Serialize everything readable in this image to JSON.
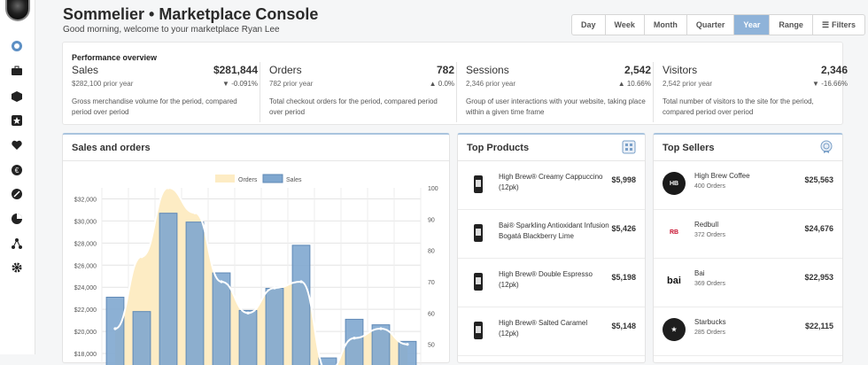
{
  "header": {
    "title": "Sommelier • Marketplace Console",
    "greeting": "Good morning, welcome to your marketplace Ryan Lee"
  },
  "ranges": [
    {
      "label": "Day",
      "active": false
    },
    {
      "label": "Week",
      "active": false
    },
    {
      "label": "Month",
      "active": false
    },
    {
      "label": "Quarter",
      "active": false
    },
    {
      "label": "Year",
      "active": true
    },
    {
      "label": "Range",
      "active": false
    },
    {
      "label": "Filters",
      "active": false,
      "icon": "sliders-icon"
    }
  ],
  "sidebar": {
    "icons": [
      "compass-icon",
      "briefcase-icon",
      "cube-icon",
      "star-box-icon",
      "heart-icon",
      "euro-icon",
      "tag-icon",
      "pie-icon",
      "network-icon",
      "gear-icon"
    ]
  },
  "overview": {
    "title": "Performance overview",
    "metrics": [
      {
        "name": "Sales",
        "value": "$281,844",
        "prior": "$282,100 prior year",
        "delta": "-0.091%",
        "direction": "down",
        "desc": "Gross merchandise volume for the period, compared period over period"
      },
      {
        "name": "Orders",
        "value": "782",
        "prior": "782 prior year",
        "delta": "0.0%",
        "direction": "up",
        "desc": "Total checkout orders for the period, compared period over period"
      },
      {
        "name": "Sessions",
        "value": "2,542",
        "prior": "2,346 prior year",
        "delta": "10.66%",
        "direction": "up",
        "desc": "Group of user interactions with your website, taking place within a given time frame"
      },
      {
        "name": "Visitors",
        "value": "2,346",
        "prior": "2,542 prior year",
        "delta": "-16.66%",
        "direction": "down",
        "desc": "Total number of visitors to the site for the period, compared period over period"
      }
    ]
  },
  "sales_card": {
    "title": "Sales and orders"
  },
  "products_card": {
    "title": "Top Products",
    "items": [
      {
        "name": "High Brew® Creamy Cappuccino (12pk)",
        "price": "$5,998"
      },
      {
        "name": "Bai® Sparkling Antioxidant Infusion Bogatá Blackberry Lime",
        "price": "$5,426"
      },
      {
        "name": "High Brew® Double Espresso (12pk)",
        "price": "$5,198"
      },
      {
        "name": "High Brew® Salted Caramel (12pk)",
        "price": "$5,148"
      }
    ]
  },
  "sellers_card": {
    "title": "Top Sellers",
    "items": [
      {
        "name": "High Brew Coffee",
        "orders": "400 Orders",
        "amount": "$25,563",
        "logo": "high-brew-logo"
      },
      {
        "name": "Redbull",
        "orders": "372 Orders",
        "amount": "$24,676",
        "logo": "redbull-logo"
      },
      {
        "name": "Bai",
        "orders": "369 Orders",
        "amount": "$22,953",
        "logo": "bai-logo"
      },
      {
        "name": "Starbucks",
        "orders": "285 Orders",
        "amount": "$22,115",
        "logo": "starbucks-logo"
      }
    ]
  },
  "chart_data": {
    "type": "bar",
    "legend": [
      "Orders",
      "Sales"
    ],
    "legend_position": "top",
    "colors": {
      "orders": "#fdecc4",
      "sales": "#7fa7cf",
      "sales_border": "#5f89b6"
    },
    "y_left": {
      "ticks": [
        "$32,000",
        "$30,000",
        "$28,000",
        "$26,000",
        "$24,000",
        "$22,000",
        "$20,000",
        "$18,000"
      ],
      "min": 16000,
      "max": 33000
    },
    "y_right": {
      "ticks": [
        "100",
        "90",
        "80",
        "70",
        "60",
        "50"
      ],
      "min": 40,
      "max": 100
    },
    "series": [
      {
        "name": "Sales",
        "values": [
          23100,
          21800,
          30700,
          29900,
          25300,
          21900,
          23900,
          27800,
          17600,
          21100,
          20600,
          19100
        ]
      },
      {
        "name": "Orders",
        "values": [
          55,
          78,
          100,
          92,
          70,
          60,
          68,
          70,
          41,
          52,
          55,
          50
        ]
      }
    ],
    "grid": true
  }
}
